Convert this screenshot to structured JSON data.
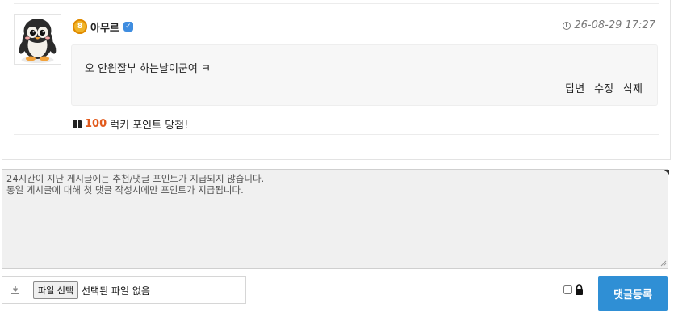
{
  "comment": {
    "username": "아무르",
    "level": "8",
    "timestamp": "26-08-29 17:27",
    "text": "오 안원잘부 하는날이군여 ㅋ",
    "actions": {
      "reply": "답변",
      "edit": "수정",
      "delete": "삭제"
    },
    "lucky": {
      "points": "100",
      "suffix": "럭키 포인트 당첨!"
    }
  },
  "editor": {
    "placeholder": "24시간이 지난 게시글에는 추천/댓글 포인트가 지급되지 않습니다.\n동일 게시글에 대해 첫 댓글 작성시에만 포인트가 지급됩니다."
  },
  "file": {
    "button_label": "파일 선택",
    "status": "선택된 파일 없음"
  },
  "submit_label": "댓글등록",
  "colors": {
    "accent": "#2f8fd5",
    "points": "#e25a1c",
    "verified": "#3f8de0",
    "level_badge": "#f0b429"
  },
  "icons": [
    "penguin-avatar",
    "level-badge-icon",
    "verified-icon",
    "clock-icon",
    "gift-icon",
    "upload-icon",
    "lock-icon"
  ]
}
